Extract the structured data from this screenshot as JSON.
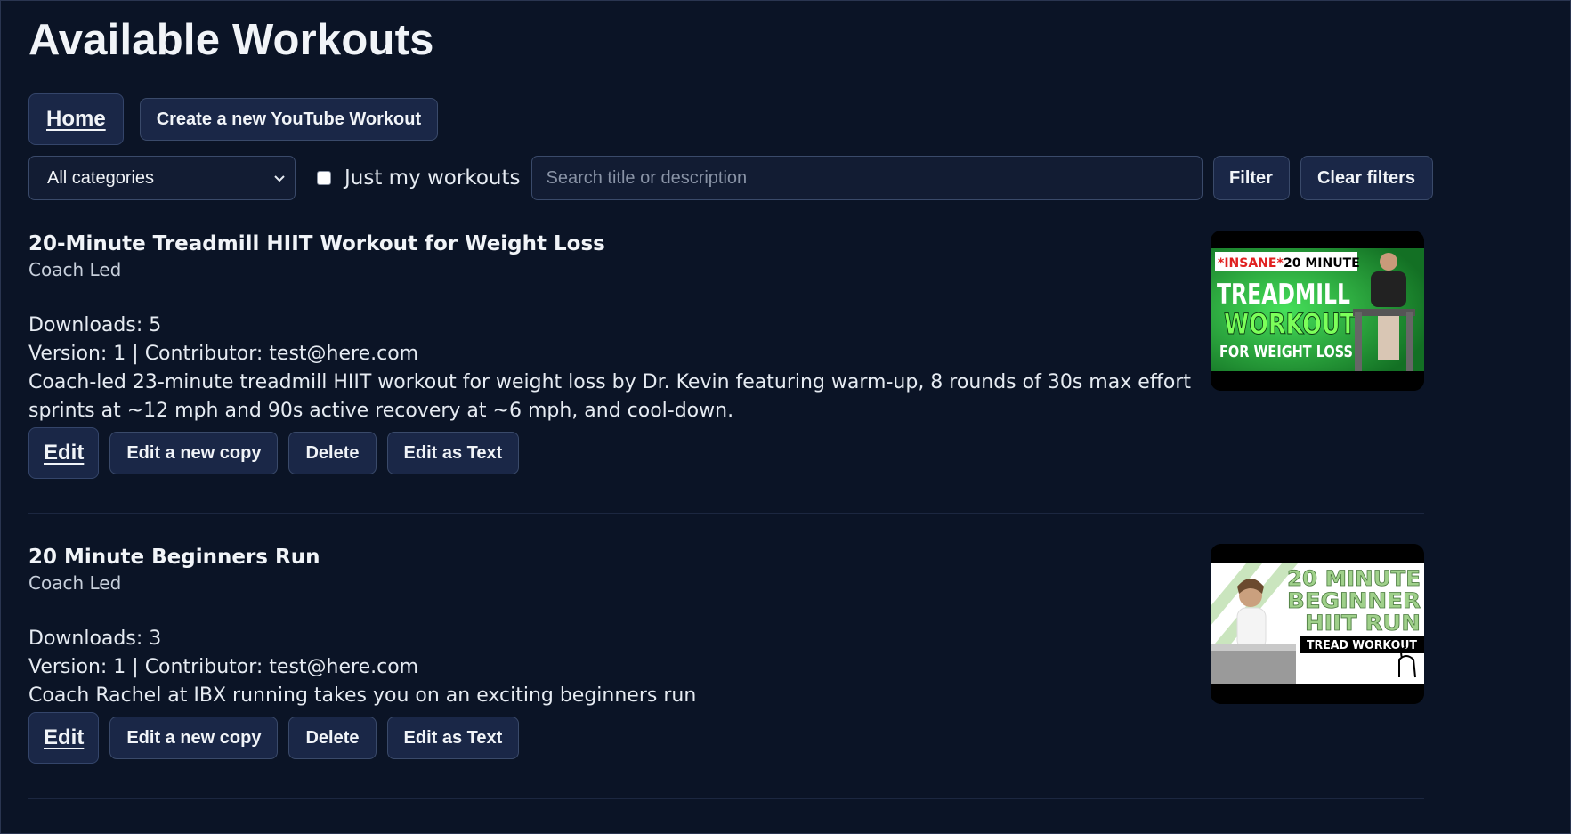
{
  "header": {
    "title": "Available Workouts"
  },
  "nav": {
    "home_label": "Home",
    "create_label": "Create a new YouTube Workout"
  },
  "filters": {
    "category_selected": "All categories",
    "just_mine_label": "Just my workouts",
    "just_mine_checked": false,
    "search_placeholder": "Search title or description",
    "search_value": "",
    "filter_label": "Filter",
    "clear_label": "Clear filters"
  },
  "workouts": [
    {
      "title": "20-Minute Treadmill HIIT Workout for Weight Loss",
      "category": "Coach Led",
      "downloads": "Downloads: 5",
      "version_line": "Version: 1 | Contributor: test@here.com",
      "description": "Coach-led 23-minute treadmill HIIT workout for weight loss by Dr. Kevin featuring warm-up, 8 rounds of 30s max effort sprints at ~12 mph and 90s active recovery at ~6 mph, and cool-down.",
      "thumbnail": {
        "tag": "*INSANE*",
        "line1": "20 MINUTE",
        "line2": "TREADMILL",
        "line3": "WORKOUT",
        "line4": "FOR WEIGHT LOSS",
        "accent": "#39d353"
      },
      "actions": {
        "edit": "Edit",
        "copy": "Edit a new copy",
        "delete": "Delete",
        "text": "Edit as Text"
      }
    },
    {
      "title": "20 Minute Beginners Run",
      "category": "Coach Led",
      "downloads": "Downloads: 3",
      "version_line": "Version: 1 | Contributor: test@here.com",
      "description": "Coach Rachel at IBX running takes you on an exciting beginners run",
      "thumbnail": {
        "line1": "20 MINUTE",
        "line2": "BEGINNER",
        "line3": "HIIT RUN",
        "line4": "TREAD WORKOUT",
        "accent": "#9fd08a"
      },
      "actions": {
        "edit": "Edit",
        "copy": "Edit a new copy",
        "delete": "Delete",
        "text": "Edit as Text"
      }
    }
  ],
  "colors": {
    "background": "#0b1426",
    "button_bg": "#1a2747",
    "border": "#3a4a6a"
  }
}
